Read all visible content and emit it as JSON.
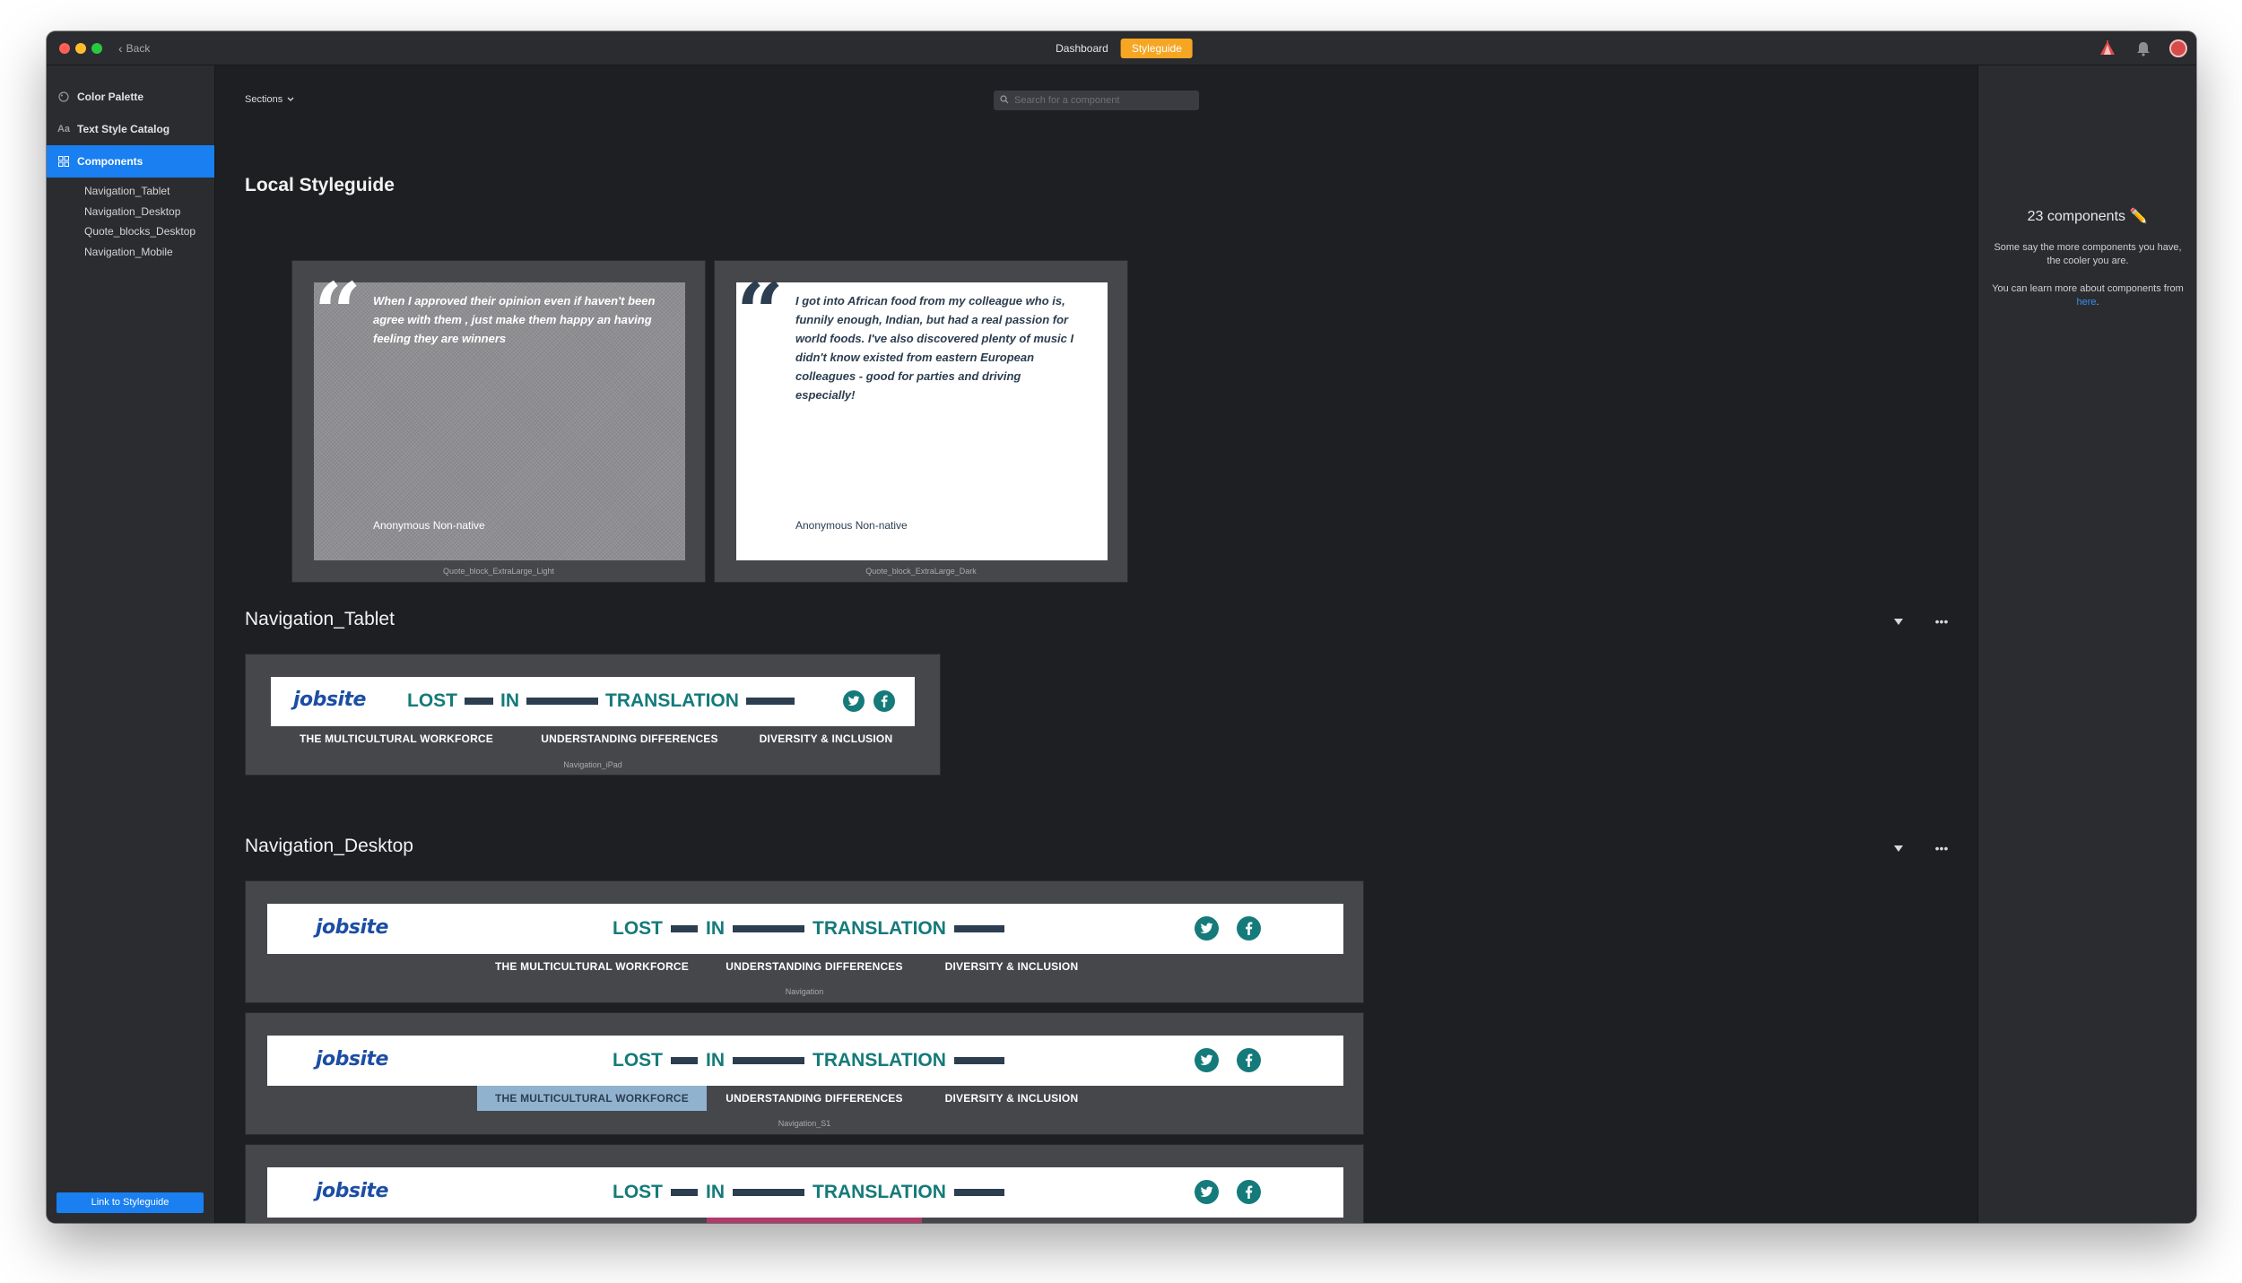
{
  "titlebar": {
    "back_label": "Back",
    "tabs": [
      {
        "label": "Dashboard",
        "active": false
      },
      {
        "label": "Styleguide",
        "active": true
      }
    ],
    "icons": [
      "tent-icon",
      "bell-icon",
      "avatar"
    ]
  },
  "sidebar": {
    "items": [
      {
        "label": "Color Palette",
        "icon": "palette-icon"
      },
      {
        "label": "Text Style Catalog",
        "icon": "text-style-icon"
      },
      {
        "label": "Components",
        "icon": "components-icon",
        "active": true
      }
    ],
    "subitems": [
      "Navigation_Tablet",
      "Navigation_Desktop",
      "Quote_blocks_Desktop",
      "Navigation_Mobile"
    ],
    "link_button": "Link to Styleguide"
  },
  "toolbar": {
    "sections_label": "Sections",
    "search_placeholder": "Search for a component"
  },
  "local_styleguide": {
    "title": "Local Styleguide",
    "cards": [
      {
        "label": "Quote_block_ExtraLarge_Light",
        "quote": "When I approved their opinion even if haven't been agree with them , just make them happy an having feeling they are winners",
        "author": "Anonymous Non-native"
      },
      {
        "label": "Quote_block_ExtraLarge_Dark",
        "quote": "I got into African food from my colleague who is, funnily enough, Indian, but had a real passion for world foods. I've also discovered plenty of music I didn't know existed from eastern European colleagues - good for parties and driving especially!",
        "author": "Anonymous Non-native"
      }
    ]
  },
  "brand": {
    "logo": "jobsite",
    "title_words": [
      "LOST",
      "IN",
      "TRANSLATION"
    ],
    "nav_items": [
      "THE MULTICULTURAL WORKFORCE",
      "UNDERSTANDING DIFFERENCES",
      "DIVERSITY & INCLUSION"
    ],
    "social_icons": [
      "twitter-icon",
      "facebook-icon"
    ],
    "colors": {
      "teal": "#157a7a",
      "navy": "#2c3e50",
      "logo_blue": "#1c4ea3",
      "highlight_blue": "#91b2cf",
      "highlight_pink": "#b03a6b"
    }
  },
  "navigation_tablet": {
    "title": "Navigation_Tablet",
    "card_label": "Navigation_iPad"
  },
  "navigation_desktop": {
    "title": "Navigation_Desktop",
    "card_labels": [
      "Navigation",
      "Navigation_S1"
    ]
  },
  "right_panel": {
    "count": "23 components ✏️",
    "text1": "Some say the more components you have, the cooler you are.",
    "text2_prefix": "You can learn more about components from ",
    "text2_link": "here",
    "text2_suffix": "."
  },
  "colors": {
    "accent_orange": "#f6a623",
    "accent_blue": "#1a7ff0"
  }
}
